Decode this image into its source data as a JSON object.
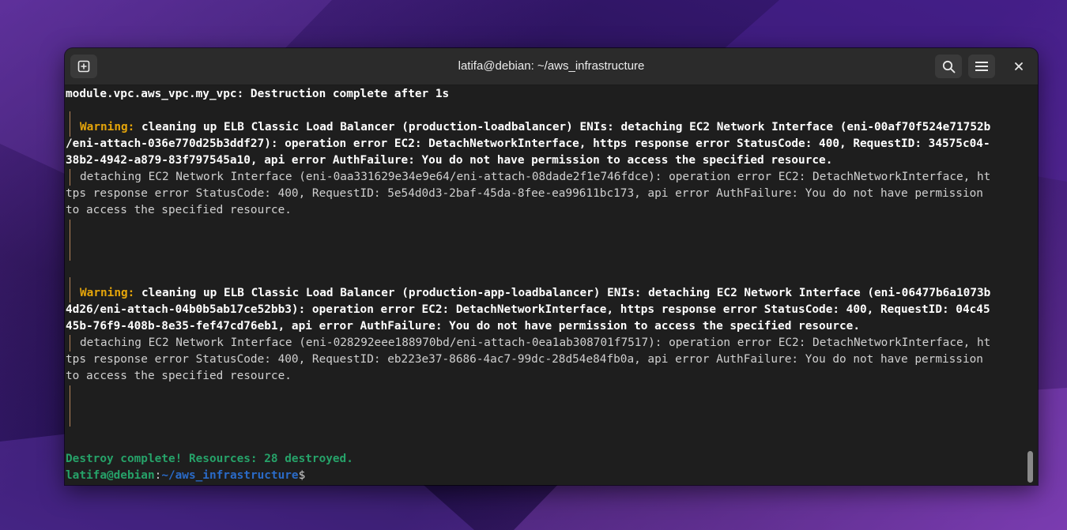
{
  "window": {
    "title": "latifa@debian: ~/aws_infrastructure"
  },
  "terminal": {
    "lines": [
      "module.vpc.aws_vpc.my_vpc: Destruction complete after 1s",
      "Warning: ",
      "cleaning up ELB Classic Load Balancer (production-loadbalancer) ENIs: detaching EC2 Network Interface (eni-00af70f524e71752b",
      "/eni-attach-036e770d25b3ddf27): operation error EC2: DetachNetworkInterface, https response error StatusCode: 400, RequestID: 34575c04-",
      "38b2-4942-a879-83f797545a10, api error AuthFailure: You do not have permission to access the specified resource.",
      "detaching EC2 Network Interface (eni-0aa331629e34e9e64/eni-attach-08dade2f1e746fdce): operation error EC2: DetachNetworkInterface, ht",
      "tps response error StatusCode: 400, RequestID: 5e54d0d3-2baf-45da-8fee-ea99611bc173, api error AuthFailure: You do not have permission",
      "to access the specified resource.",
      "Warning: ",
      "cleaning up ELB Classic Load Balancer (production-app-loadbalancer) ENIs: detaching EC2 Network Interface (eni-06477b6a1073b",
      "4d26/eni-attach-04b0b5ab17ce52bb3): operation error EC2: DetachNetworkInterface, https response error StatusCode: 400, RequestID: 04c45",
      "45b-76f9-408b-8e35-fef47cd76eb1, api error AuthFailure: You do not have permission to access the specified resource.",
      "detaching EC2 Network Interface (eni-028292eee188970bd/eni-attach-0ea1ab308701f7517): operation error EC2: DetachNetworkInterface, ht",
      "tps response error StatusCode: 400, RequestID: eb223e37-8686-4ac7-99dc-28d54e84fb0a, api error AuthFailure: You do not have permission",
      "to access the specified resource.",
      "Destroy complete! Resources: 28 destroyed."
    ],
    "prompt": {
      "user_host": "latifa@debian",
      "separator": ":",
      "path": "~/aws_infrastructure",
      "symbol": "$"
    }
  },
  "icons": {
    "new_tab": "new-tab-icon",
    "search": "search-icon",
    "menu": "hamburger-menu-icon",
    "close": "close-icon"
  },
  "colors": {
    "warning": "#e5a50a",
    "success": "#26a269",
    "path": "#2a6bc8",
    "gutter": "#b5835a",
    "terminal_bg": "#1e1e1e"
  }
}
